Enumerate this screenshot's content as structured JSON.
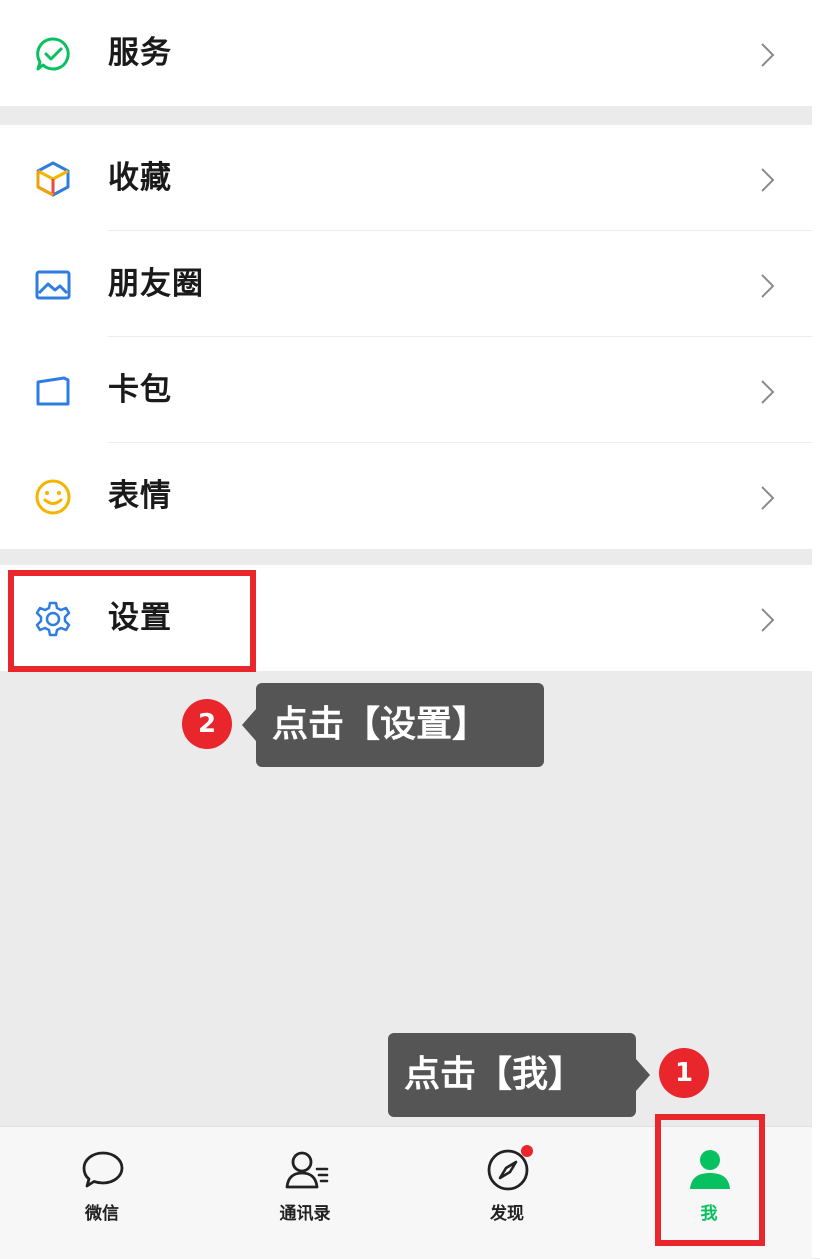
{
  "menu": {
    "service": "服务",
    "favorites": "收藏",
    "moments": "朋友圈",
    "cards": "卡包",
    "stickers": "表情",
    "settings": "设置"
  },
  "annotations": {
    "step2_number": "2",
    "step2_text": "点击【设置】",
    "step1_number": "1",
    "step1_text": "点击【我】"
  },
  "tabbar": {
    "chats": "微信",
    "contacts": "通讯录",
    "discover": "发现",
    "me": "我",
    "active": "me"
  },
  "colors": {
    "accent_green": "#07c160",
    "highlight_red": "#e8262b",
    "tooltip_bg": "#555555"
  },
  "icons": {
    "service": "service-icon",
    "favorites": "favorites-cube-icon",
    "moments": "moments-picture-icon",
    "cards": "card-wallet-icon",
    "stickers": "smiley-icon",
    "settings": "gear-icon",
    "chevron": "chevron-right-icon"
  }
}
